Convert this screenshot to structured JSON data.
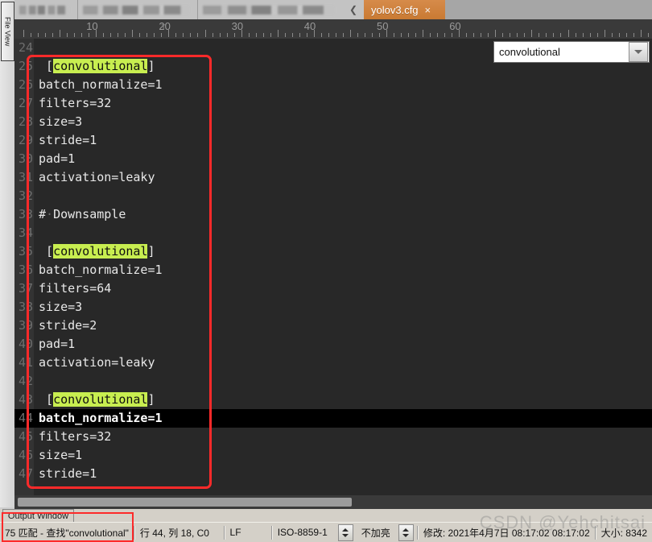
{
  "window": {
    "left_dock_tab": "File View"
  },
  "tabs": {
    "hidden_tabs": [
      "",
      "",
      ""
    ],
    "scroll_left_icon": "chevron-left-icon",
    "active": {
      "label": "yolov3.cfg",
      "close_icon": "×"
    }
  },
  "ruler": {
    "labels": [
      10,
      20,
      30,
      40,
      50,
      60
    ],
    "marker_glyph": "T",
    "marker_column": 19
  },
  "search": {
    "value": "convolutional",
    "placeholder": "",
    "dropdown_icon": "chevron-down-icon"
  },
  "editor": {
    "current_line": 44,
    "highlight_token": "convolutional",
    "lines": [
      {
        "no": 24,
        "pre": "",
        "hl": "",
        "post": ""
      },
      {
        "no": 25,
        "pre": " [",
        "hl": "convolutional",
        "post": "]"
      },
      {
        "no": 26,
        "pre": "batch_normalize=1",
        "hl": "",
        "post": ""
      },
      {
        "no": 27,
        "pre": "filters=32",
        "hl": "",
        "post": ""
      },
      {
        "no": 28,
        "pre": "size=3",
        "hl": "",
        "post": ""
      },
      {
        "no": 29,
        "pre": "stride=1",
        "hl": "",
        "post": ""
      },
      {
        "no": 30,
        "pre": "pad=1",
        "hl": "",
        "post": ""
      },
      {
        "no": 31,
        "pre": "activation=leaky",
        "hl": "",
        "post": ""
      },
      {
        "no": 32,
        "pre": "",
        "hl": "",
        "post": ""
      },
      {
        "no": 33,
        "pre": "#·Downsample",
        "hl": "",
        "post": ""
      },
      {
        "no": 34,
        "pre": "",
        "hl": "",
        "post": ""
      },
      {
        "no": 35,
        "pre": " [",
        "hl": "convolutional",
        "post": "]"
      },
      {
        "no": 36,
        "pre": "batch_normalize=1",
        "hl": "",
        "post": ""
      },
      {
        "no": 37,
        "pre": "filters=64",
        "hl": "",
        "post": ""
      },
      {
        "no": 38,
        "pre": "size=3",
        "hl": "",
        "post": ""
      },
      {
        "no": 39,
        "pre": "stride=2",
        "hl": "",
        "post": ""
      },
      {
        "no": 40,
        "pre": "pad=1",
        "hl": "",
        "post": ""
      },
      {
        "no": 41,
        "pre": "activation=leaky",
        "hl": "",
        "post": ""
      },
      {
        "no": 42,
        "pre": "",
        "hl": "",
        "post": ""
      },
      {
        "no": 43,
        "pre": " [",
        "hl": "convolutional",
        "post": "]"
      },
      {
        "no": 44,
        "pre": "batch_normalize=1",
        "hl": "",
        "post": ""
      },
      {
        "no": 45,
        "pre": "filters=32",
        "hl": "",
        "post": ""
      },
      {
        "no": 46,
        "pre": "size=1",
        "hl": "",
        "post": ""
      },
      {
        "no": 47,
        "pre": "stride=1",
        "hl": "",
        "post": ""
      }
    ]
  },
  "output_panel": {
    "tab_label": "Output Window"
  },
  "statusbar": {
    "find_result": "75 匹配 - 查找\"convolutional\"",
    "caret": "行 44, 列 18, C0",
    "eol": "LF",
    "encoding": "ISO-8859-1",
    "highlight_mode": "不加亮",
    "modified": "修改:  2021年4月7日 08:17:02 08:17:02",
    "size": "大小:  8342"
  },
  "watermark": "CSDN @Yehchitsai",
  "colors": {
    "editor_bg": "#282828",
    "gutter_bg": "#333333",
    "current_line_bg": "#000000",
    "search_highlight": "#c8ee50",
    "active_tab": "#c97a33",
    "annotation_red": "#fd2a2a",
    "ruler_bg": "#3a3a3a",
    "status_bg": "#d4d0c8"
  }
}
